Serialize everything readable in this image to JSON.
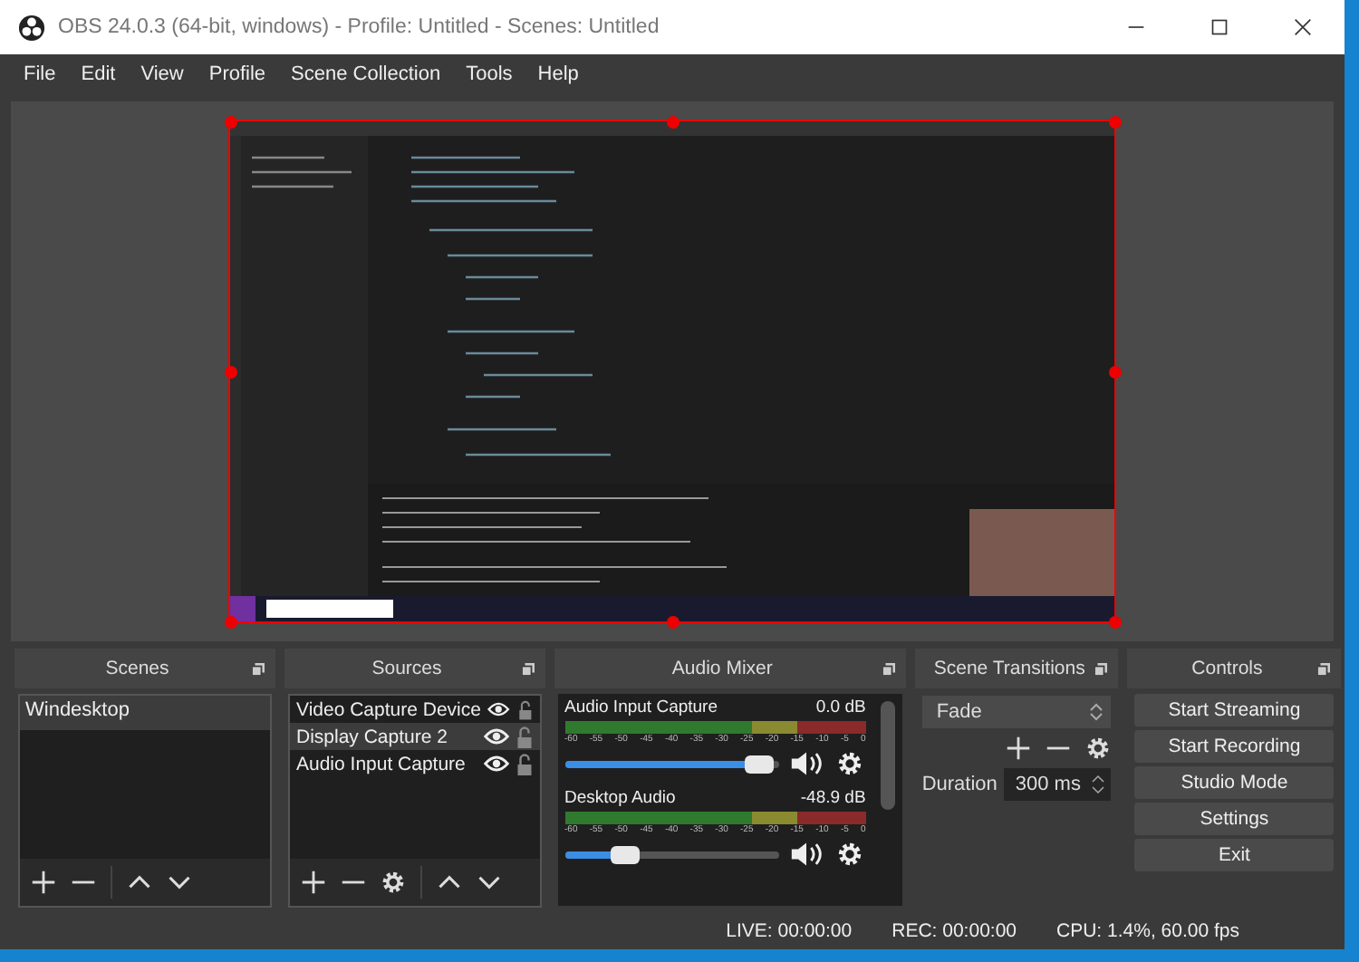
{
  "window": {
    "title": "OBS 24.0.3 (64-bit, windows) - Profile: Untitled - Scenes: Untitled"
  },
  "menu": [
    "File",
    "Edit",
    "View",
    "Profile",
    "Scene Collection",
    "Tools",
    "Help"
  ],
  "scenes": {
    "title": "Scenes",
    "items": [
      {
        "label": "Windesktop",
        "selected": true
      }
    ]
  },
  "sources": {
    "title": "Sources",
    "items": [
      {
        "label": "Video Capture Device",
        "selected": false,
        "visible": true,
        "locked": false
      },
      {
        "label": "Display Capture 2",
        "selected": true,
        "visible": true,
        "locked": false
      },
      {
        "label": "Audio Input Capture",
        "selected": false,
        "visible": true,
        "locked": false
      }
    ]
  },
  "mixer": {
    "title": "Audio Mixer",
    "channels": [
      {
        "name": "Audio Input Capture",
        "reading": "0.0 dB",
        "level": 0.97,
        "scale": [
          "-60",
          "-55",
          "-50",
          "-45",
          "-40",
          "-35",
          "-30",
          "-25",
          "-20",
          "-15",
          "-10",
          "-5",
          "0"
        ]
      },
      {
        "name": "Desktop Audio",
        "reading": "-48.9 dB",
        "level": 0.25,
        "scale": [
          "-60",
          "-55",
          "-50",
          "-45",
          "-40",
          "-35",
          "-30",
          "-25",
          "-20",
          "-15",
          "-10",
          "-5",
          "0"
        ]
      }
    ]
  },
  "transitions": {
    "title": "Scene Transitions",
    "transition": "Fade",
    "duration_label": "Duration",
    "duration": "300 ms"
  },
  "controls": {
    "title": "Controls",
    "buttons": [
      "Start Streaming",
      "Start Recording",
      "Studio Mode",
      "Settings",
      "Exit"
    ]
  },
  "status_bar": {
    "live": "LIVE: 00:00:00",
    "rec": "REC: 00:00:00",
    "cpu": "CPU: 1.4%, 60.00 fps"
  }
}
